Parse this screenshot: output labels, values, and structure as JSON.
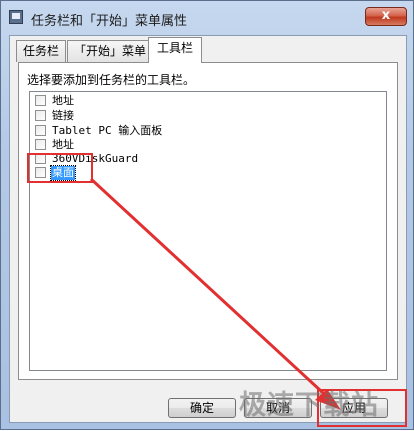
{
  "window": {
    "title": "任务栏和「开始」菜单属性",
    "close_label": "x"
  },
  "tabs": [
    {
      "label": "任务栏",
      "active": false
    },
    {
      "label": "「开始」菜单",
      "active": false
    },
    {
      "label": "工具栏",
      "active": true
    }
  ],
  "panel": {
    "instruction": "选择要添加到任务栏的工具栏。",
    "toolbars": [
      {
        "label": "地址",
        "checked": false
      },
      {
        "label": "链接",
        "checked": false
      },
      {
        "label": "Tablet PC 输入面板",
        "checked": false
      },
      {
        "label": "地址",
        "checked": false
      },
      {
        "label": "360VDiskGuard",
        "checked": false
      },
      {
        "label": "桌面",
        "checked": false,
        "selected": true
      }
    ]
  },
  "buttons": {
    "ok": "确定",
    "cancel": "取消",
    "apply": "应用"
  },
  "watermark": "极速下载站",
  "colors": {
    "annotation_red": "#e23030",
    "selection_blue": "#3399ff",
    "close_red": "#c0391e"
  }
}
